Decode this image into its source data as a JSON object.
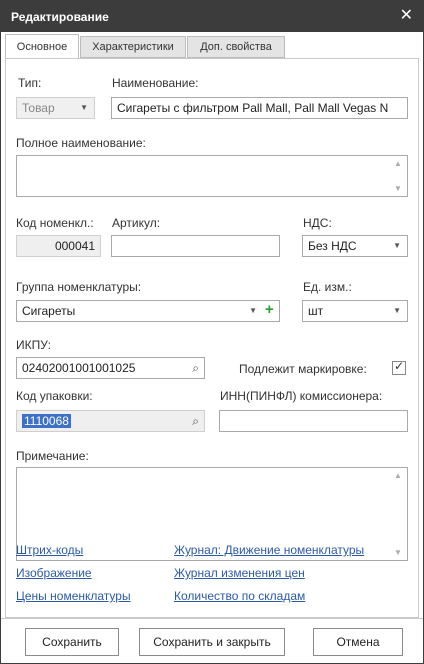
{
  "window": {
    "title": "Редактирование",
    "close": "✕"
  },
  "tabs": [
    "Основное",
    "Характеристики",
    "Доп. свойства"
  ],
  "form": {
    "type_label": "Тип:",
    "type_value": "Товар",
    "name_label": "Наименование:",
    "name_value": "Сигареты с фильтром Pall Mall, Pall Mall Vegas N",
    "fullname_label": "Полное наименование:",
    "fullname_value": "",
    "code_label": "Код номенкл.:",
    "code_value": "000041",
    "article_label": "Артикул:",
    "article_value": "",
    "vat_label": "НДС:",
    "vat_value": "Без НДС",
    "group_label": "Группа номенклатуры:",
    "group_value": "Сигареты",
    "unit_label": "Ед. изм.:",
    "unit_value": "шт",
    "ikpu_label": "ИКПУ:",
    "ikpu_value": "02402001001001025",
    "marking_label": "Подлежит маркировке:",
    "marking_checked": true,
    "pack_label": "Код упаковки:",
    "pack_value": "1110068",
    "inn_label": "ИНН(ПИНФЛ) комиссионера:",
    "inn_value": "",
    "note_label": "Примечание:",
    "note_value": ""
  },
  "links": {
    "barcodes": "Штрих-коды",
    "image": "Изображение",
    "prices": "Цены номенклатуры",
    "journal_movement": "Журнал: Движение номенклатуры",
    "journal_prices": "Журнал изменения цен",
    "qty_by_warehouse": "Количество по складам"
  },
  "buttons": {
    "save": "Сохранить",
    "save_close": "Сохранить и закрыть",
    "cancel": "Отмена"
  },
  "icons": {
    "close": "close-icon",
    "search": "search-icon",
    "dropdown": "chevron-down-icon",
    "add": "plus-icon",
    "check": "checkmark-icon"
  }
}
